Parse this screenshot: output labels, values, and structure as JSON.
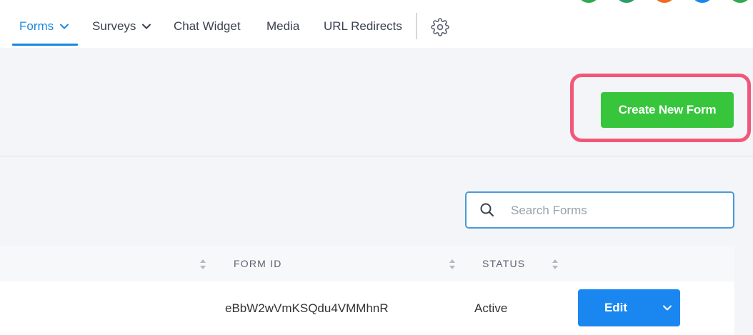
{
  "nav": {
    "items": [
      {
        "label": "Forms",
        "has_dropdown": true,
        "active": true
      },
      {
        "label": "Surveys",
        "has_dropdown": true,
        "active": false
      },
      {
        "label": "Chat Widget",
        "has_dropdown": false,
        "active": false
      },
      {
        "label": "Media",
        "has_dropdown": false,
        "active": false
      },
      {
        "label": "URL Redirects",
        "has_dropdown": false,
        "active": false
      }
    ],
    "settings_icon": "gear-icon",
    "accent_color": "#1a87e0",
    "avatar_colors": [
      "#2eaa4f",
      "#2a9d6a",
      "#f26b21",
      "#1a87f0",
      "#2eaa4f"
    ]
  },
  "header": {
    "create_label": "Create New Form",
    "create_color": "#37c53c",
    "highlight_color": "#f2577a"
  },
  "search": {
    "placeholder": "Search Forms",
    "value": ""
  },
  "table": {
    "columns": [
      "FORM ID",
      "STATUS"
    ],
    "rows": [
      {
        "form_id": "eBbW2wVmKSQdu4VMMhnR",
        "status": "Active",
        "action_label": "Edit"
      }
    ]
  }
}
